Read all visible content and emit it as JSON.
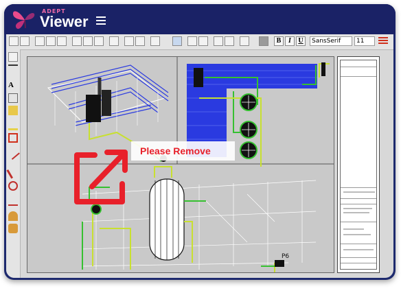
{
  "app": {
    "brand_small": "ADEPT",
    "brand_name": "Viewer"
  },
  "colors": {
    "header": "#1a2266",
    "accent": "#f06aa8",
    "annotation": "#e8202a"
  },
  "toolbar": {
    "font_family": "SansSerif",
    "font_size": "11",
    "bold_label": "B",
    "italic_label": "I",
    "underline_label": "U"
  },
  "annotation": {
    "label": "Please Remove"
  },
  "drawing": {
    "label_p6": "P6"
  }
}
